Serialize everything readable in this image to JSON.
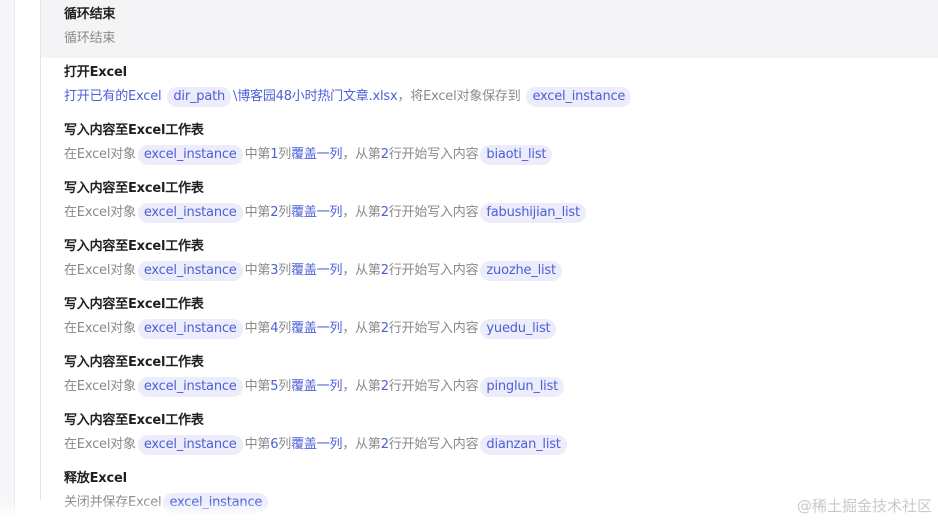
{
  "loop_end": {
    "title": "循环结束",
    "desc": "循环结束"
  },
  "open_excel": {
    "title": "打开Excel",
    "prefix": "打开已有的Excel",
    "path_var": "dir_path",
    "path_suffix": "\\博客园48小时热门文章.xlsx",
    "mid": "，将Excel对象保存到",
    "save_var": "excel_instance"
  },
  "write_steps": [
    {
      "title": "写入内容至Excel工作表",
      "prefix": "在Excel对象",
      "instance": "excel_instance",
      "mid1": "中第",
      "col": "1",
      "mid2": "列",
      "mode": "覆盖一列",
      "mid3": "，从第",
      "row": "2",
      "mid4": "行开始写入内容",
      "var": "biaoti_list"
    },
    {
      "title": "写入内容至Excel工作表",
      "prefix": "在Excel对象",
      "instance": "excel_instance",
      "mid1": "中第",
      "col": "2",
      "mid2": "列",
      "mode": "覆盖一列",
      "mid3": "，从第",
      "row": "2",
      "mid4": "行开始写入内容",
      "var": "fabushijian_list"
    },
    {
      "title": "写入内容至Excel工作表",
      "prefix": "在Excel对象",
      "instance": "excel_instance",
      "mid1": "中第",
      "col": "3",
      "mid2": "列",
      "mode": "覆盖一列",
      "mid3": "，从第",
      "row": "2",
      "mid4": "行开始写入内容",
      "var": "zuozhe_list"
    },
    {
      "title": "写入内容至Excel工作表",
      "prefix": "在Excel对象",
      "instance": "excel_instance",
      "mid1": "中第",
      "col": "4",
      "mid2": "列",
      "mode": "覆盖一列",
      "mid3": "，从第",
      "row": "2",
      "mid4": "行开始写入内容",
      "var": "yuedu_list"
    },
    {
      "title": "写入内容至Excel工作表",
      "prefix": "在Excel对象",
      "instance": "excel_instance",
      "mid1": "中第",
      "col": "5",
      "mid2": "列",
      "mode": "覆盖一列",
      "mid3": "，从第",
      "row": "2",
      "mid4": "行开始写入内容",
      "var": "pinglun_list"
    },
    {
      "title": "写入内容至Excel工作表",
      "prefix": "在Excel对象",
      "instance": "excel_instance",
      "mid1": "中第",
      "col": "6",
      "mid2": "列",
      "mode": "覆盖一列",
      "mid3": "，从第",
      "row": "2",
      "mid4": "行开始写入内容",
      "var": "dianzan_list"
    }
  ],
  "release_excel": {
    "title": "释放Excel",
    "prefix": "关闭并保存Excel",
    "var": "excel_instance"
  },
  "watermark": "@稀土掘金技术社区"
}
